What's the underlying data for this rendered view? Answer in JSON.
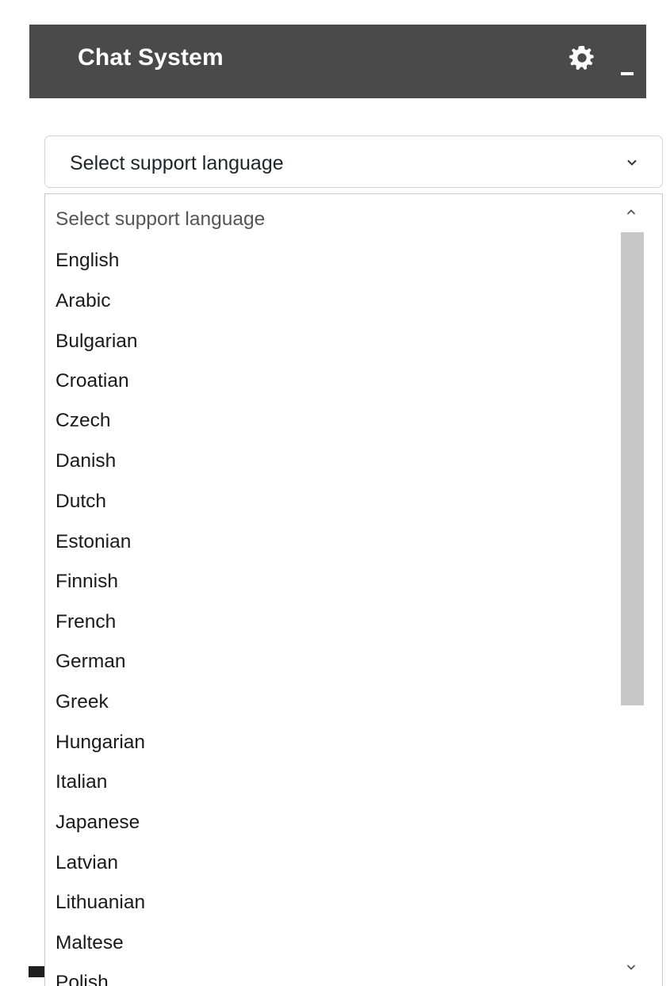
{
  "header": {
    "title": "Chat System",
    "settings_icon": "gear-icon",
    "minimize_icon": "minimize-icon",
    "minimize_label": "_",
    "background_color": "#4a4a4a"
  },
  "language_select": {
    "selected_value": "Select support language",
    "chevron_icon": "chevron-down-icon"
  },
  "dropdown": {
    "options": [
      "Select support language",
      "English",
      "Arabic",
      "Bulgarian",
      "Croatian",
      "Czech",
      "Danish",
      "Dutch",
      "Estonian",
      "Finnish",
      "French",
      "German",
      "Greek",
      "Hungarian",
      "Italian",
      "Japanese",
      "Latvian",
      "Lithuanian",
      "Maltese",
      "Polish"
    ],
    "scrollbar": {
      "up_icon": "chevron-up-icon",
      "down_icon": "chevron-down-icon",
      "thumb_color": "#c8c8c8"
    }
  }
}
